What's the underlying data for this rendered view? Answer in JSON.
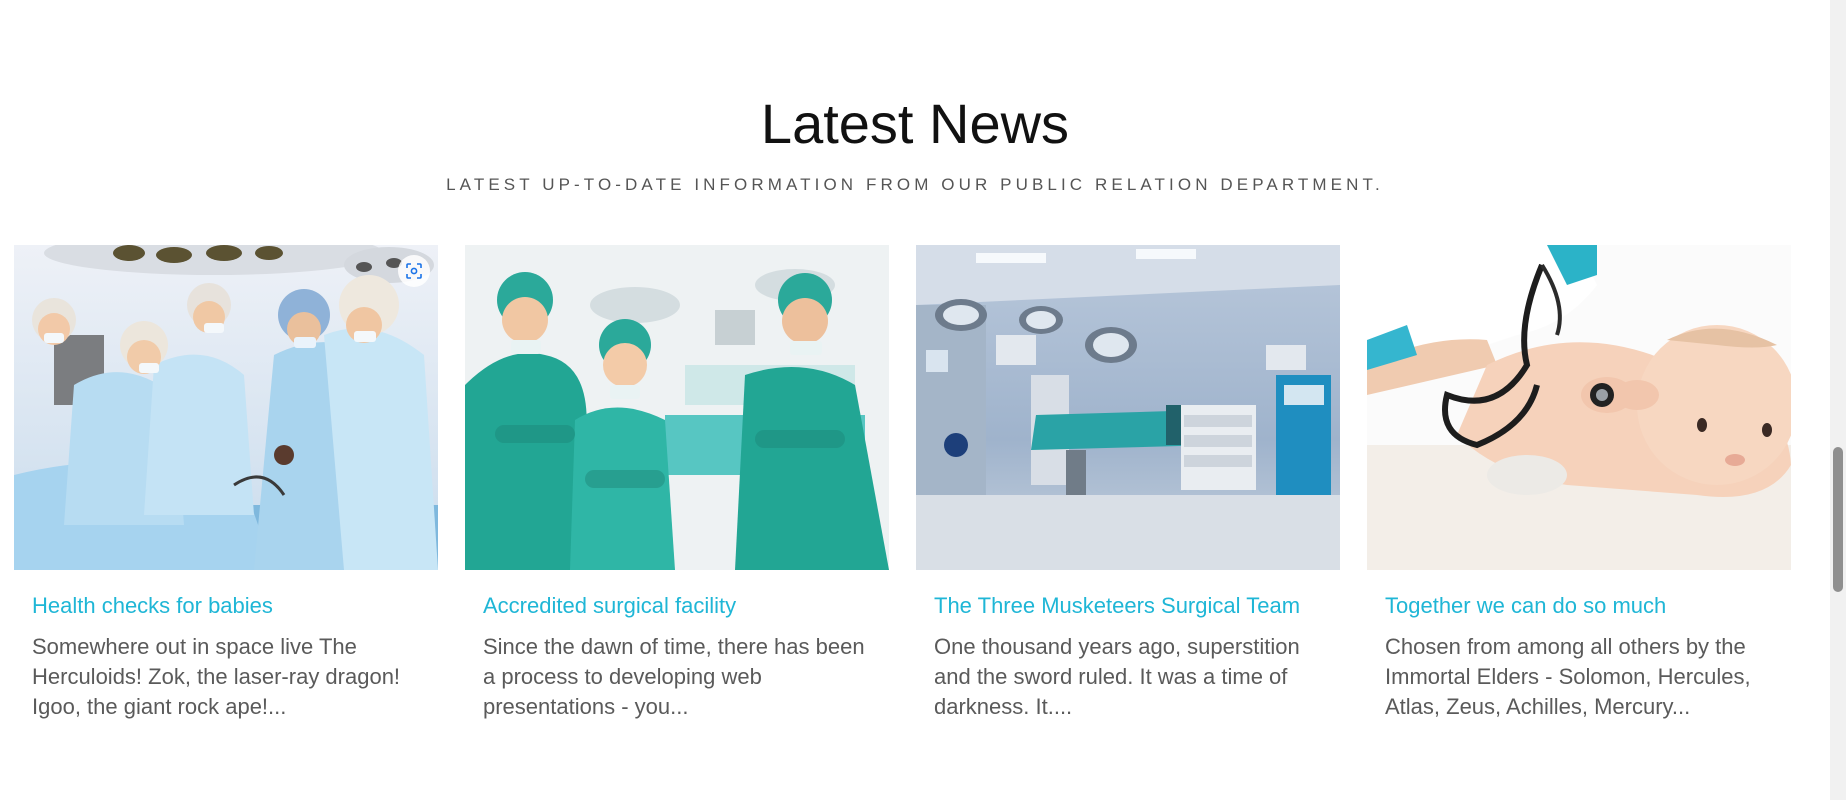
{
  "section": {
    "title": "Latest News",
    "subtitle": "LATEST UP-TO-DATE INFORMATION FROM OUR PUBLIC RELATION DEPARTMENT."
  },
  "cards": [
    {
      "title": "Health checks for babies",
      "excerpt": "Somewhere out in space live The Herculoids! Zok, the laser-ray dragon! Igoo, the giant rock ape!...",
      "image": "surgeons-operating-photo"
    },
    {
      "title": "Accredited surgical facility",
      "excerpt": "Since the dawn of time, there has been a process to developing web presentations - you...",
      "image": "surgical-team-posing-photo"
    },
    {
      "title": "The Three Musketeers Surgical Team",
      "excerpt": "One thousand years ago, superstition and the sword ruled. It was a time of darkness. It....",
      "image": "operating-room-photo"
    },
    {
      "title": "Together we can do so much",
      "excerpt": "Chosen from among all others by the Immortal Elders - Solomon, Hercules, Atlas, Zeus, Achilles, Mercury...",
      "image": "baby-stethoscope-photo"
    }
  ],
  "colors": {
    "link": "#1fb6d6",
    "text": "#5a5a5a",
    "heading": "#111111"
  }
}
